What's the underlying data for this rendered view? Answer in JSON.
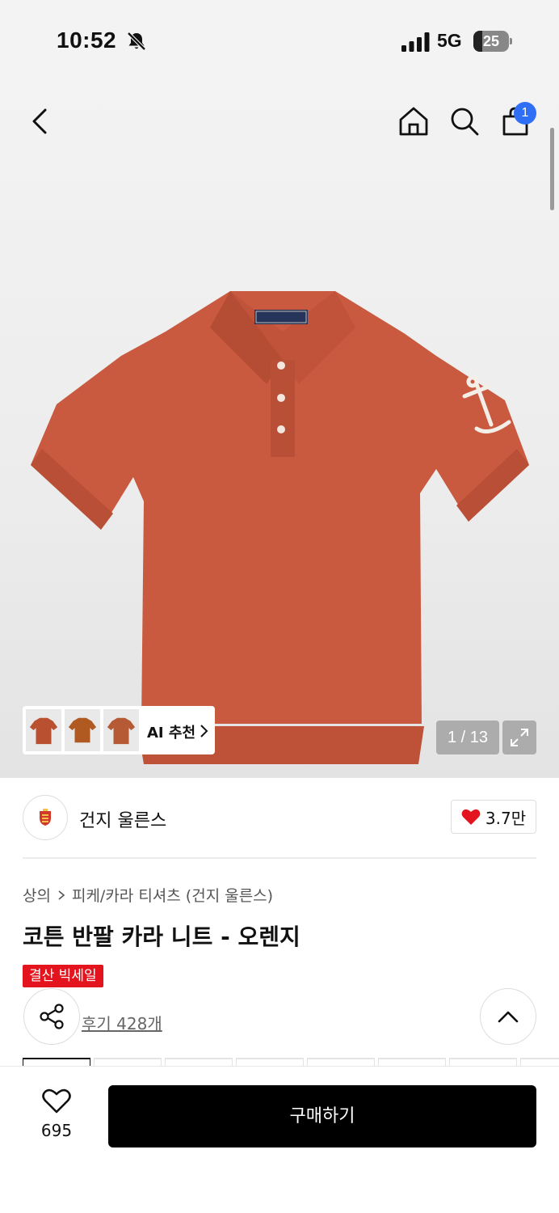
{
  "status_bar": {
    "time": "10:52",
    "network": "5G",
    "battery": "25",
    "battery_level": 0.25,
    "icons": [
      "bell-slash-icon",
      "signal-icon",
      "battery-icon"
    ]
  },
  "nav": {
    "icons": [
      "back-icon",
      "home-icon",
      "search-icon",
      "cart-icon"
    ],
    "cart_count": "1"
  },
  "gallery": {
    "ai_label": "AI 추천",
    "counter": "1 / 13",
    "thumbnail_count": 3
  },
  "brand": {
    "name": "건지 울른스",
    "likes": "3.7만",
    "like_color": "#e3141d"
  },
  "breadcrumb": {
    "level1": "상의",
    "level2": "피케/카라 티셔츠 (건지 울른스)"
  },
  "product": {
    "title": "코튼 반팔 카라 니트 - 오렌지",
    "sale_badge": "결산 빅세일",
    "review_link": "후기 428개",
    "color": "#c95a3f"
  },
  "bottom_bar": {
    "wish_count": "695",
    "buy_label": "구매하기"
  },
  "colors": {
    "accent_blue": "#2f6ff5",
    "sale_red": "#e3141d",
    "buy_button": "#000000"
  }
}
